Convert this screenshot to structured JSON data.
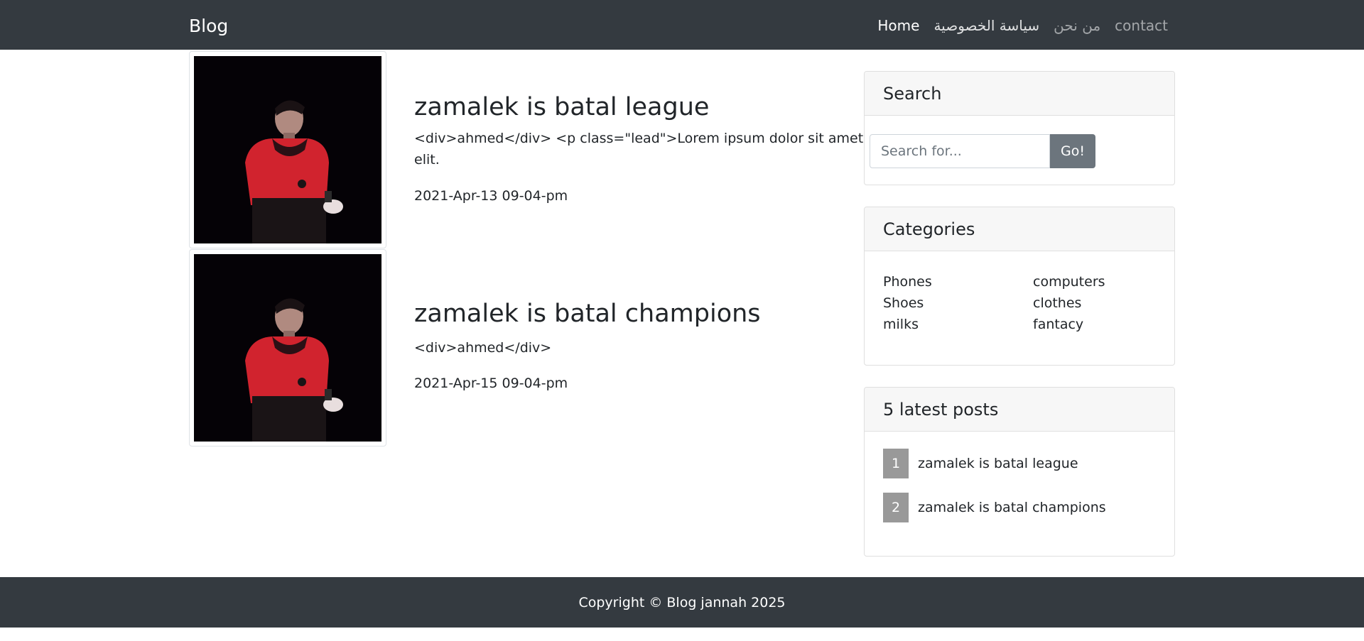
{
  "navbar": {
    "brand": "Blog",
    "links": [
      {
        "label": "Home"
      },
      {
        "label": "سياسة الخصوصية"
      },
      {
        "label": "من نحن"
      },
      {
        "label": "contact"
      }
    ]
  },
  "posts": [
    {
      "title": "zamalek is batal league",
      "body": "<div>ahmed</div> <p class=\"lead\">Lorem ipsum dolor sit amet, consectetur adipisicing elit.",
      "date": "2021-Apr-13 09-04-pm"
    },
    {
      "title": "zamalek is batal champions",
      "body": "<div>ahmed</div>",
      "date": "2021-Apr-15 09-04-pm"
    }
  ],
  "sidebar": {
    "search": {
      "title": "Search",
      "placeholder": "Search for...",
      "button": "Go!"
    },
    "categories": {
      "title": "Categories",
      "items": [
        "Phones",
        "computers",
        "Shoes",
        "clothes",
        "milks",
        "fantacy"
      ]
    },
    "latest": {
      "title": "5 latest posts",
      "items": [
        {
          "num": "1",
          "title": "zamalek is batal league"
        },
        {
          "num": "2",
          "title": "zamalek is batal champions"
        }
      ]
    }
  },
  "footer": {
    "text": "Copyright © Blog jannah 2025"
  },
  "colors": {
    "navbar_bg": "#343a40",
    "button_secondary": "#6c757d",
    "badge_gray": "#999999"
  }
}
